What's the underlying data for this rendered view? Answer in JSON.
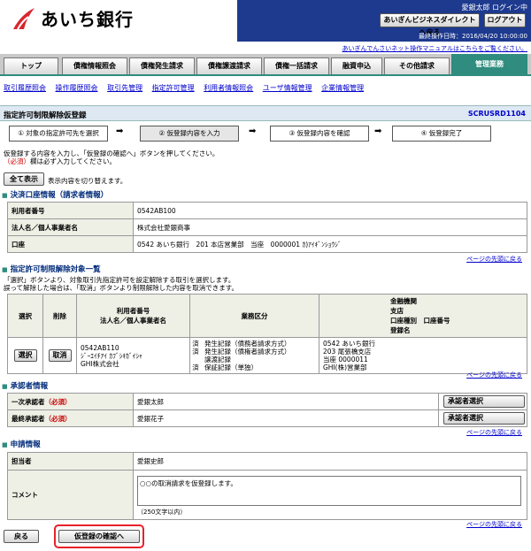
{
  "header": {
    "bank_name": "あいち銀行",
    "user_name": "愛銀太郎 ログイン中",
    "direct_button": "あいぎんビジネスダイレクトへ戻る",
    "logout_button": "ログアウト",
    "last_operation": "最終操作日時：2016/04/20 10:00:00",
    "manual_link": "あいぎんでんさいネット操作マニュアルはこちらをご覧ください。"
  },
  "tabs": [
    "トップ",
    "債権情報照会",
    "債権発生請求",
    "債権譲渡請求",
    "債権一括請求",
    "融資申込",
    "その他請求",
    "管理業務"
  ],
  "subnav": [
    "取引履歴照会",
    "操作履歴照会",
    "取引先管理",
    "指定許可管理",
    "利用者情報照会",
    "ユーザ情報管理",
    "企業情報管理"
  ],
  "page": {
    "title": "指定許可制限解除仮登録",
    "screen_id": "SCRUSRD1104"
  },
  "steps": [
    "① 対象の指定許可先を選択",
    "② 仮登録内容を入力",
    "③ 仮登録内容を確認",
    "④ 仮登録完了"
  ],
  "instructions": {
    "line1": "仮登録する内容を入力し、「仮登録の確認へ」ボタンを押してください。",
    "line2_req": "（必須）",
    "line2_rest": "欄は必ず入力してください。"
  },
  "show_all": {
    "button": "全て表示",
    "note": "表示内容を切り替えます。"
  },
  "settlement": {
    "heading": "決済口座情報（請求者情報）",
    "rows": [
      {
        "label": "利用者番号",
        "value": "0542AB100"
      },
      {
        "label": "法人名／個人事業者名",
        "value": "株式会社愛銀商事"
      },
      {
        "label": "口座",
        "value": "0542 あいち銀行　201 本店営業部　当座　0000001 ｶ)ｱｲｷﾞﾝｼｮｳｼﾞ"
      }
    ]
  },
  "to_top": "ページの先頭に戻る",
  "targets": {
    "heading": "指定許可制限解除対象一覧",
    "note1": "「選択」ボタンより、対象取引先指定許可を設定解除する取引を選択します。",
    "note2": "誤って解除した場合は、「取消」ボタンより制限解除した内容を取消できます。",
    "headers": {
      "select": "選択",
      "delete": "削除",
      "user": "利用者番号\n法人名／個人事業者名",
      "business": "業務区分",
      "bank": "金融機関\n支店\n口座種別　口座番号\n登録名"
    },
    "row": {
      "select_button": "選択",
      "cancel_button": "取消",
      "user": "0542AB110\nｼﾞｰｴｲﾁｱｲ ｶﾌﾞｼｷｶﾞｲｼｬ\nGHI株式会社",
      "business_marks": "済\n済\n\n済",
      "business": "発生記録（債務者請求方式）\n発生記録（債権者請求方式）\n譲渡記録\n保証記録（単独）",
      "bank": "0542 あいち銀行\n203 尾張橋支店\n当座 0000011\nGHI(株)営業部"
    }
  },
  "approvers": {
    "heading": "承認者情報",
    "rows": [
      {
        "label": "一次承認者",
        "req": "（必須）",
        "value": "愛銀太郎",
        "button": "承認者選択"
      },
      {
        "label": "最終承認者",
        "req": "（必須）",
        "value": "愛銀花子",
        "button": "承認者選択"
      }
    ]
  },
  "application": {
    "heading": "申請情報",
    "person_label": "担当者",
    "person_value": "愛銀史郎",
    "comment_label": "コメント",
    "comment_value": "○○の取消請求を仮登録します。",
    "comment_limit": "（250文字以内）"
  },
  "footer": {
    "back_button": "戻る",
    "confirm_button": "仮登録の確認へ"
  },
  "colors": {
    "header_blue": "#1d3a8f",
    "active_tab": "#2f8c7e",
    "logo_red": "#d8262e",
    "required_red": "#cc0000",
    "highlight_ring": "#e8202a"
  }
}
